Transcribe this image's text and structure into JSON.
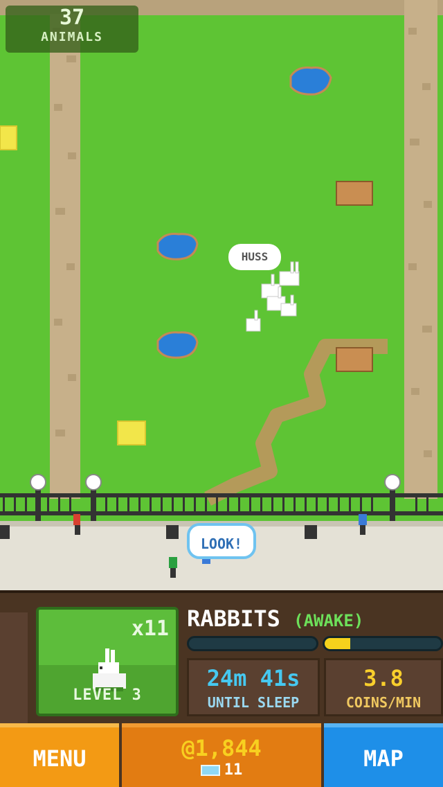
{
  "counter": {
    "value": "37",
    "label": "ANIMALS"
  },
  "speech": {
    "animal": "HUSS",
    "visitor": "LOOK!"
  },
  "animal": {
    "name": "RABBITS",
    "state": "(AWAKE)",
    "multiplier": "x11",
    "level": "LEVEL 3"
  },
  "stats": {
    "sleep_value": "24m 41s",
    "sleep_label": "UNTIL SLEEP",
    "coins_rate": "3.8",
    "coins_rate_label": "COINS/MIN",
    "coin_progress": 0.22
  },
  "footer": {
    "menu_label": "MENU",
    "coins": "1,844",
    "coin_symbol": "@",
    "gems": "11",
    "map_label": "MAP"
  },
  "icons": {
    "rabbit": "rabbit-icon",
    "gem": "gem-icon",
    "coin": "coin-icon"
  },
  "colors": {
    "grass": "#5ec434",
    "path": "#b49a5a",
    "menu": "#f39a14",
    "map": "#1e8fe8",
    "coins": "#f8d020"
  }
}
